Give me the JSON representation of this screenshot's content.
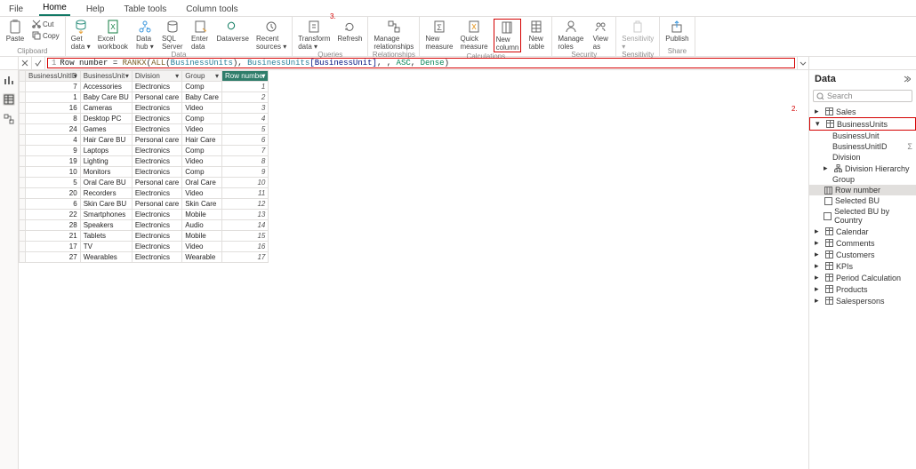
{
  "tabs": [
    "File",
    "Home",
    "Help",
    "Table tools",
    "Column tools"
  ],
  "tabs_active_index": 1,
  "ribbon": {
    "clipboard": {
      "paste": "Paste",
      "cut": "Cut",
      "copy": "Copy",
      "label": "Clipboard"
    },
    "data": {
      "get_data": "Get\ndata ▾",
      "excel": "Excel\nworkbook",
      "data_hub": "Data\nhub ▾",
      "sql": "SQL\nServer",
      "enter": "Enter\ndata",
      "dataverse": "Dataverse",
      "recent": "Recent\nsources ▾",
      "label": "Data"
    },
    "queries": {
      "transform": "Transform\ndata ▾",
      "refresh": "Refresh",
      "label": "Queries"
    },
    "relationships": {
      "manage": "Manage\nrelationships",
      "label": "Relationships"
    },
    "calculations": {
      "new_measure": "New\nmeasure",
      "quick_measure": "Quick\nmeasure",
      "new_column": "New\ncolumn",
      "new_table": "New\ntable",
      "label": "Calculations"
    },
    "security": {
      "manage_roles": "Manage\nroles",
      "view_as": "View\nas",
      "label": "Security"
    },
    "sensitivity": {
      "btn": "Sensitivity\n▾",
      "label": "Sensitivity"
    },
    "share": {
      "publish": "Publish",
      "label": "Share"
    }
  },
  "formula": {
    "line_no": "1",
    "text": "Row number = RANKX(ALL(BusinessUnits), BusinessUnits[BusinessUnit], , ASC, Dense)",
    "lhs": "Row number ",
    "eq": "= ",
    "fn1": "RANKX",
    "p1": "(",
    "fn2": "ALL",
    "p2": "(",
    "ref1": "BusinessUnits",
    "p3": "), ",
    "ref2": "BusinessUnits",
    "col1": "[BusinessUnit]",
    "p4": ", , ",
    "en1": "ASC",
    "p5": ", ",
    "en2": "Dense",
    "p6": ")"
  },
  "columns": [
    "BusinessUnitID",
    "BusinessUnit",
    "Division",
    "Group",
    "Row number"
  ],
  "rows": [
    {
      "id": 7,
      "bu": "Accessories",
      "div": "Electronics",
      "grp": "Comp",
      "rn": 1
    },
    {
      "id": 1,
      "bu": "Baby Care BU",
      "div": "Personal care",
      "grp": "Baby Care",
      "rn": 2
    },
    {
      "id": 16,
      "bu": "Cameras",
      "div": "Electronics",
      "grp": "Video",
      "rn": 3
    },
    {
      "id": 8,
      "bu": "Desktop PC",
      "div": "Electronics",
      "grp": "Comp",
      "rn": 4
    },
    {
      "id": 24,
      "bu": "Games",
      "div": "Electronics",
      "grp": "Video",
      "rn": 5
    },
    {
      "id": 4,
      "bu": "Hair Care BU",
      "div": "Personal care",
      "grp": "Hair Care",
      "rn": 6
    },
    {
      "id": 9,
      "bu": "Laptops",
      "div": "Electronics",
      "grp": "Comp",
      "rn": 7
    },
    {
      "id": 19,
      "bu": "Lighting",
      "div": "Electronics",
      "grp": "Video",
      "rn": 8
    },
    {
      "id": 10,
      "bu": "Monitors",
      "div": "Electronics",
      "grp": "Comp",
      "rn": 9
    },
    {
      "id": 5,
      "bu": "Oral Care BU",
      "div": "Personal care",
      "grp": "Oral Care",
      "rn": 10
    },
    {
      "id": 20,
      "bu": "Recorders",
      "div": "Electronics",
      "grp": "Video",
      "rn": 11
    },
    {
      "id": 6,
      "bu": "Skin Care BU",
      "div": "Personal care",
      "grp": "Skin Care",
      "rn": 12
    },
    {
      "id": 22,
      "bu": "Smartphones",
      "div": "Electronics",
      "grp": "Mobile",
      "rn": 13
    },
    {
      "id": 28,
      "bu": "Speakers",
      "div": "Electronics",
      "grp": "Audio",
      "rn": 14
    },
    {
      "id": 21,
      "bu": "Tablets",
      "div": "Electronics",
      "grp": "Mobile",
      "rn": 15
    },
    {
      "id": 17,
      "bu": "TV",
      "div": "Electronics",
      "grp": "Video",
      "rn": 16
    },
    {
      "id": 27,
      "bu": "Wearables",
      "div": "Electronics",
      "grp": "Wearable",
      "rn": 17
    }
  ],
  "panel": {
    "title": "Data",
    "search_placeholder": "Search",
    "tables": {
      "sales": "Sales",
      "business_units": "BusinessUnits",
      "business_unit_col": "BusinessUnit",
      "business_unit_id": "BusinessUnitID",
      "division": "Division",
      "division_hierarchy": "Division Hierarchy",
      "group": "Group",
      "row_number": "Row number",
      "selected_bu": "Selected BU",
      "selected_bu_by_country": "Selected BU by Country",
      "calendar": "Calendar",
      "comments": "Comments",
      "customers": "Customers",
      "kpis": "KPIs",
      "period_calc": "Period Calculation",
      "products": "Products",
      "salespersons": "Salespersons"
    }
  },
  "annotations": {
    "n2": "2.",
    "n3": "3."
  }
}
